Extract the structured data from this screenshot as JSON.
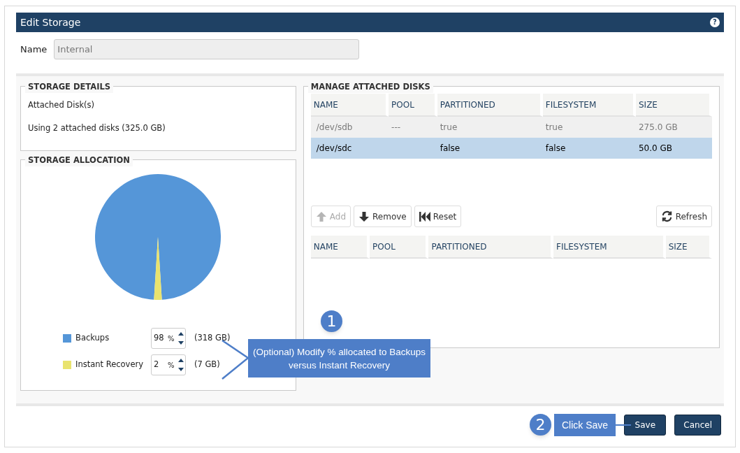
{
  "window": {
    "title": "Edit Storage",
    "help_icon": "?"
  },
  "name_field": {
    "label": "Name",
    "value": "Internal",
    "disabled": true
  },
  "storage_details": {
    "title": "STORAGE DETAILS",
    "lines": [
      "Attached Disk(s)",
      "Using 2 attached disks (325.0 GB)"
    ]
  },
  "storage_allocation": {
    "title": "STORAGE ALLOCATION",
    "chart_data": {
      "type": "pie",
      "values": [
        98,
        2
      ]
    },
    "items": [
      {
        "label": "Backups",
        "color": "#5596d8",
        "percent": "98",
        "unit": "%",
        "size": "(318 GB)"
      },
      {
        "label": "Instant Recovery",
        "color": "#e9e36e",
        "percent": "2",
        "unit": "%",
        "size": "(7 GB)"
      }
    ]
  },
  "manage_disks": {
    "title": "MANAGE ATTACHED DISKS",
    "available": {
      "columns": [
        "NAME",
        "POOL",
        "PARTITIONED",
        "FILESYSTEM",
        "SIZE"
      ],
      "rows": [
        {
          "cells": [
            "/dev/sdb",
            "---",
            "true",
            "true",
            "275.0 GB"
          ],
          "selected": false,
          "disabled": true
        },
        {
          "cells": [
            "/dev/sdc",
            "",
            "false",
            "false",
            "50.0 GB"
          ],
          "selected": true,
          "disabled": false
        }
      ]
    },
    "buttons": [
      {
        "label": "Add",
        "kind": "add",
        "disabled": true
      },
      {
        "label": "Remove",
        "kind": "remove",
        "disabled": false
      },
      {
        "label": "Reset",
        "kind": "reset",
        "disabled": false
      },
      {
        "label": "Refresh",
        "kind": "refresh",
        "disabled": false
      }
    ],
    "attached": {
      "columns": [
        "NAME",
        "POOL",
        "PARTITIONED",
        "FILESYSTEM",
        "SIZE"
      ]
    }
  },
  "callouts": [
    {
      "number": "1",
      "text": "(Optional) Modify % allocated to Backups versus Instant Recovery"
    },
    {
      "number": "2",
      "text": "Click Save"
    }
  ],
  "footer_buttons": [
    "Save",
    "Cancel"
  ]
}
